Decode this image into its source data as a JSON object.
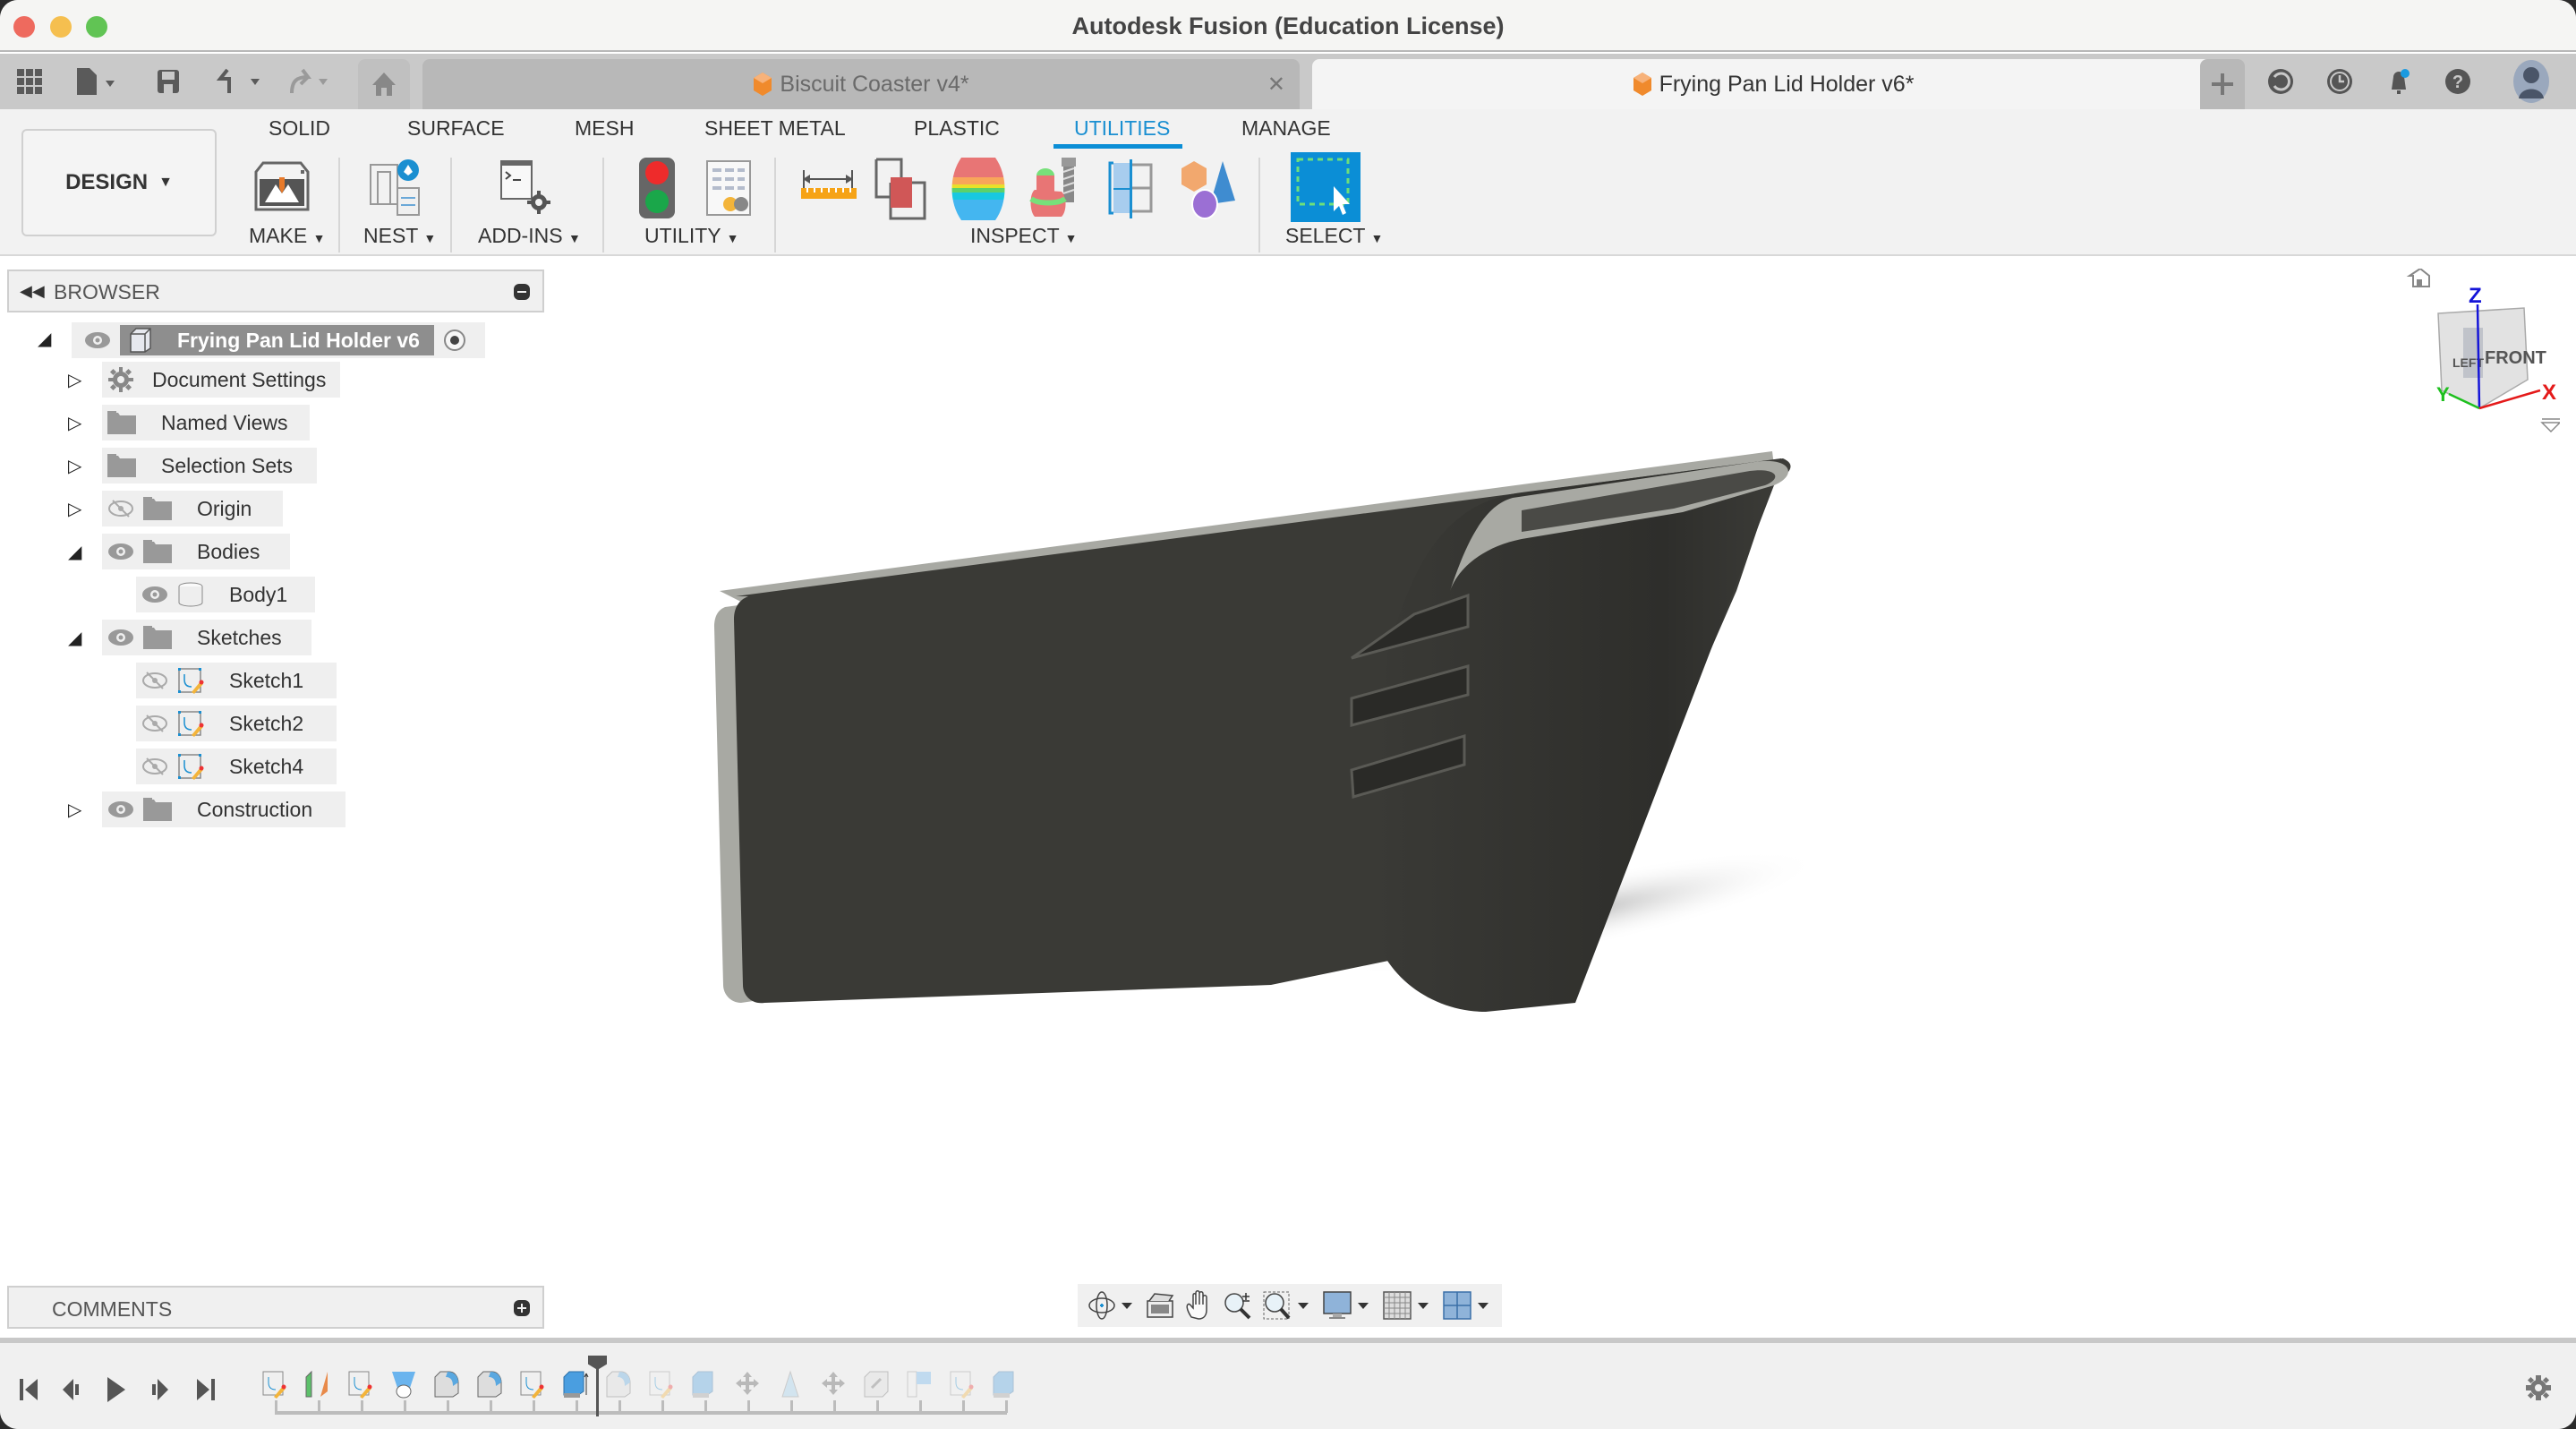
{
  "window": {
    "title": "Autodesk Fusion (Education License)"
  },
  "tabs": [
    {
      "label": "Biscuit Coaster v4*",
      "active": false
    },
    {
      "label": "Frying Pan Lid Holder v6*",
      "active": true
    }
  ],
  "toolbar": {
    "workspace_label": "DESIGN",
    "workspace_tabs": [
      "SOLID",
      "SURFACE",
      "MESH",
      "SHEET METAL",
      "PLASTIC",
      "UTILITIES",
      "MANAGE"
    ],
    "active_workspace_tab": "UTILITIES",
    "groups": [
      "MAKE",
      "NEST",
      "ADD-INS",
      "UTILITY",
      "INSPECT",
      "SELECT"
    ]
  },
  "browser": {
    "title": "BROWSER",
    "root": "Frying Pan Lid Holder v6",
    "items": [
      {
        "label": "Document Settings",
        "icon": "gear-icon",
        "expanded": false
      },
      {
        "label": "Named Views",
        "icon": "folder-icon",
        "expanded": false
      },
      {
        "label": "Selection Sets",
        "icon": "folder-icon",
        "expanded": false
      },
      {
        "label": "Origin",
        "icon": "folder-icon",
        "expanded": false,
        "visible": false
      },
      {
        "label": "Bodies",
        "icon": "folder-icon",
        "expanded": true,
        "visible": true
      },
      {
        "label": "Body1",
        "icon": "body-icon",
        "visible": true
      },
      {
        "label": "Sketches",
        "icon": "folder-icon",
        "expanded": true,
        "visible": true
      },
      {
        "label": "Sketch1",
        "icon": "sketch-icon",
        "visible": false
      },
      {
        "label": "Sketch2",
        "icon": "sketch-icon",
        "visible": false
      },
      {
        "label": "Sketch4",
        "icon": "sketch-icon",
        "visible": false
      },
      {
        "label": "Construction",
        "icon": "folder-icon",
        "expanded": false,
        "visible": true
      }
    ]
  },
  "comments": {
    "title": "COMMENTS"
  },
  "viewcube": {
    "left": "LEFT",
    "front": "FRONT",
    "axes": {
      "x": "X",
      "y": "Y",
      "z": "Z"
    }
  },
  "colors": {
    "accent": "#0b8ed6",
    "model": "#3a3a36"
  }
}
